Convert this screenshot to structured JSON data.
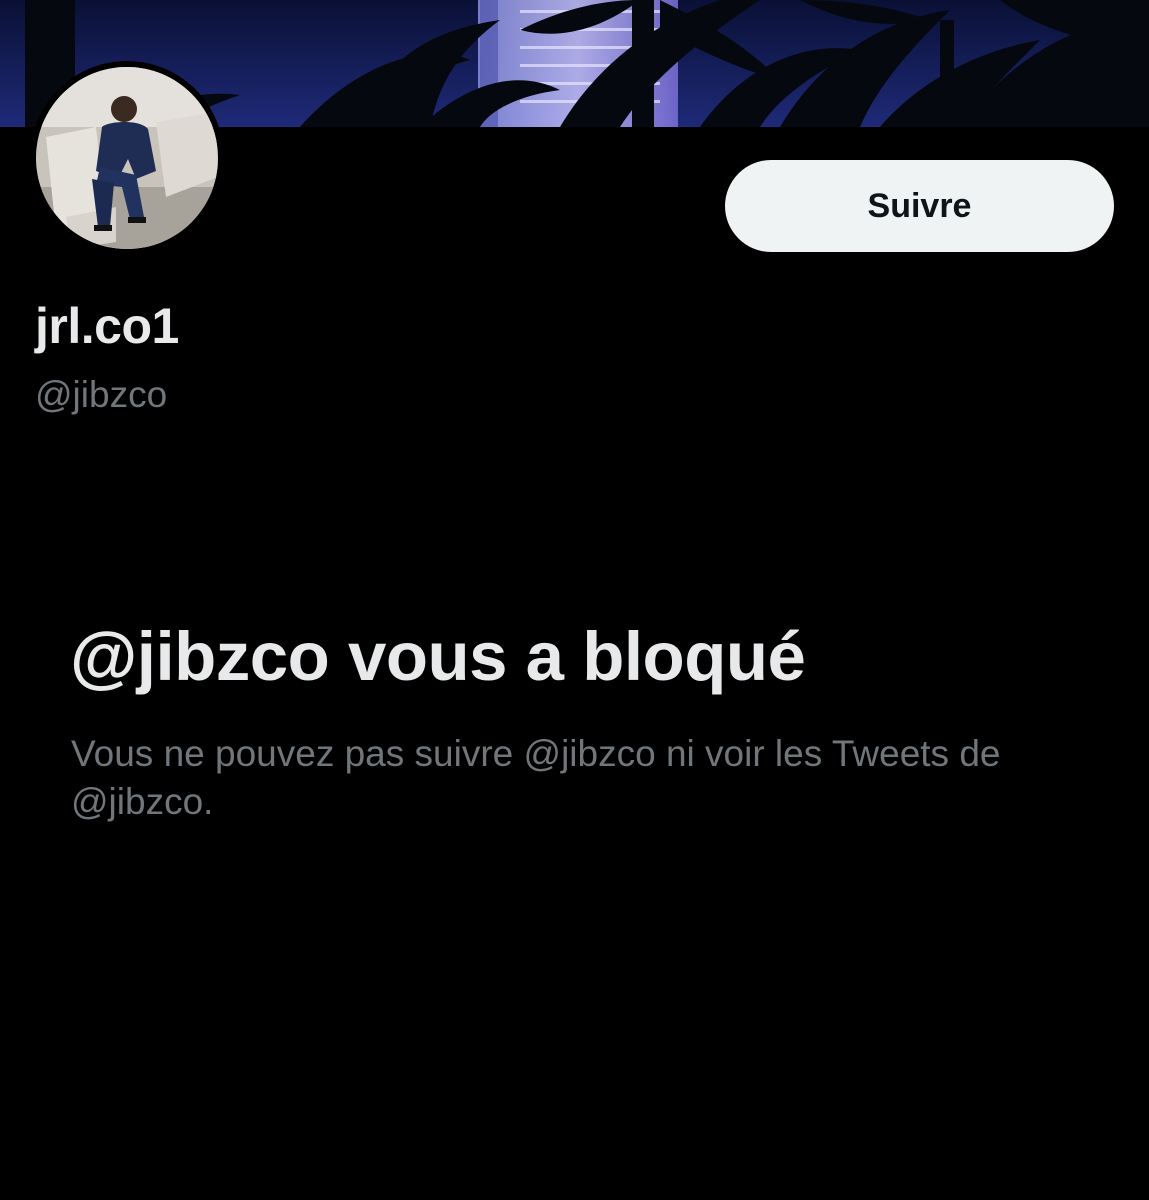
{
  "profile": {
    "display_name": "jrl.co1",
    "handle": "@jibzco",
    "follow_label": "Suivre",
    "banner_image": "night-palm-trees-hotel-banner",
    "avatar_image": "man-in-suit-seated-photo"
  },
  "blocked": {
    "title": "@jibzco vous a bloqué",
    "description": "Vous ne pouvez pas suivre @jibzco ni voir les Tweets de @jibzco."
  },
  "colors": {
    "background": "#000000",
    "primary_text": "#e7e9ea",
    "secondary_text": "#71767b",
    "follow_button_bg": "#eff3f4",
    "follow_button_text": "#0f1419"
  }
}
